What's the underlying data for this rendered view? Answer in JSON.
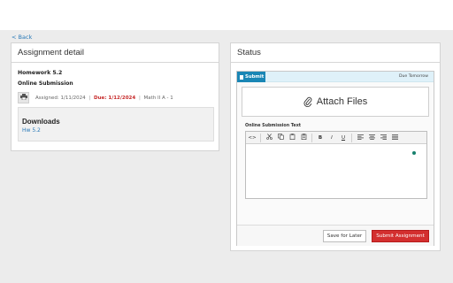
{
  "nav": {
    "back_label": "< Back"
  },
  "assignment": {
    "card_title": "Assignment detail",
    "title": "Homework 5.2",
    "submission_type": "Online Submission",
    "assigned": "Assigned: 1/11/2024",
    "separator": "|",
    "due": "Due: 1/12/2024",
    "course": "Math II A - 1",
    "downloads_title": "Downloads",
    "download_link": "Hw 5.2"
  },
  "status": {
    "card_title": "Status",
    "submit_tab": "Submit",
    "due_note": "Due Tomorrow",
    "attach_label": "Attach Files",
    "editor_label": "Online Submission Text",
    "toolbar": {
      "source": "<>",
      "bold": "B",
      "italic": "I",
      "underline": "U"
    },
    "save_later_label": "Save for Later",
    "submit_label": "Submit Assignment"
  },
  "colors": {
    "accent_blue": "#1a86b5",
    "danger_red": "#d32f2f",
    "link_blue": "#2a7ab8"
  }
}
